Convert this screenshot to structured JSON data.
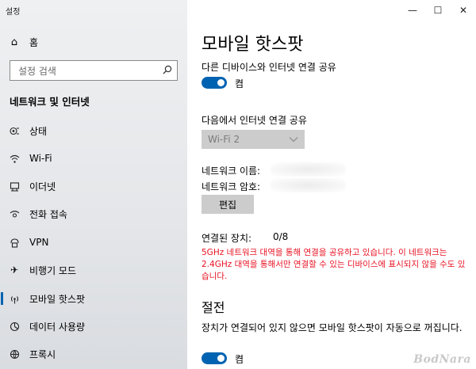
{
  "window": {
    "title": "설정"
  },
  "sidebar": {
    "home_label": "홈",
    "search_placeholder": "설정 검색",
    "section_title": "네트워크 및 인터넷",
    "items": [
      {
        "label": "상태",
        "icon": "status-icon"
      },
      {
        "label": "Wi-Fi",
        "icon": "wifi-icon"
      },
      {
        "label": "이더넷",
        "icon": "ethernet-icon"
      },
      {
        "label": "전화 접속",
        "icon": "dialup-icon"
      },
      {
        "label": "VPN",
        "icon": "vpn-icon"
      },
      {
        "label": "비행기 모드",
        "icon": "airplane-icon"
      },
      {
        "label": "모바일 핫스팟",
        "icon": "hotspot-icon",
        "active": true
      },
      {
        "label": "데이터 사용량",
        "icon": "data-usage-icon"
      },
      {
        "label": "프록시",
        "icon": "proxy-icon"
      }
    ]
  },
  "main": {
    "title": "모바일 핫스팟",
    "share_label": "다른 디바이스와 인터넷 연결 공유",
    "share_state": "켬",
    "share_from_label": "다음에서 인터넷 연결 공유",
    "share_from_value": "Wi-Fi 2",
    "network_name_label": "네트워크 이름:",
    "network_password_label": "네트워크 암호:",
    "edit_button": "편집",
    "connected_label": "연결된 장치:",
    "connected_value": "0/8",
    "warning": "5GHz 네트워크 대역을 통해 연결을 공유하고 있습니다. 이 네트워크는 2.4GHz 대역을 통해서만 연결할 수 있는 디바이스에 표시되지 않을 수도 있습니다.",
    "power_title": "절전",
    "power_desc": "장치가 연결되어 있지 않으면 모바일 핫스팟이 자동으로 꺼집니다.",
    "power_state": "켬"
  },
  "watermark": "BodNara",
  "colors": {
    "accent": "#0063b1",
    "warning": "#e81123"
  }
}
